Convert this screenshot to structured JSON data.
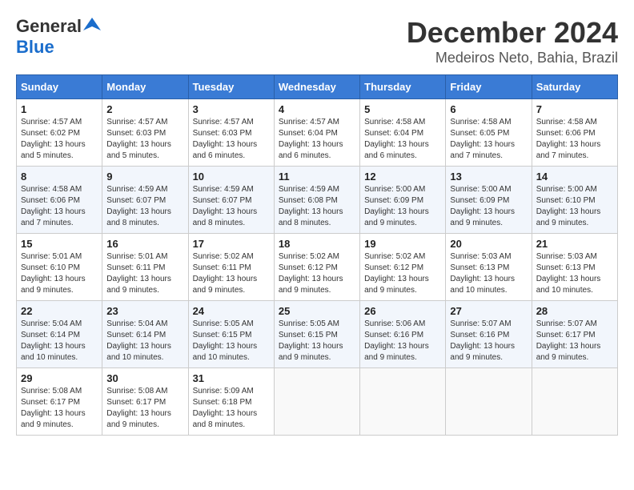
{
  "header": {
    "logo_general": "General",
    "logo_blue": "Blue",
    "month_title": "December 2024",
    "location": "Medeiros Neto, Bahia, Brazil"
  },
  "days_of_week": [
    "Sunday",
    "Monday",
    "Tuesday",
    "Wednesday",
    "Thursday",
    "Friday",
    "Saturday"
  ],
  "weeks": [
    [
      {
        "day": "1",
        "sunrise": "4:57 AM",
        "sunset": "6:02 PM",
        "daylight": "13 hours and 5 minutes."
      },
      {
        "day": "2",
        "sunrise": "4:57 AM",
        "sunset": "6:03 PM",
        "daylight": "13 hours and 5 minutes."
      },
      {
        "day": "3",
        "sunrise": "4:57 AM",
        "sunset": "6:03 PM",
        "daylight": "13 hours and 6 minutes."
      },
      {
        "day": "4",
        "sunrise": "4:57 AM",
        "sunset": "6:04 PM",
        "daylight": "13 hours and 6 minutes."
      },
      {
        "day": "5",
        "sunrise": "4:58 AM",
        "sunset": "6:04 PM",
        "daylight": "13 hours and 6 minutes."
      },
      {
        "day": "6",
        "sunrise": "4:58 AM",
        "sunset": "6:05 PM",
        "daylight": "13 hours and 7 minutes."
      },
      {
        "day": "7",
        "sunrise": "4:58 AM",
        "sunset": "6:06 PM",
        "daylight": "13 hours and 7 minutes."
      }
    ],
    [
      {
        "day": "8",
        "sunrise": "4:58 AM",
        "sunset": "6:06 PM",
        "daylight": "13 hours and 7 minutes."
      },
      {
        "day": "9",
        "sunrise": "4:59 AM",
        "sunset": "6:07 PM",
        "daylight": "13 hours and 8 minutes."
      },
      {
        "day": "10",
        "sunrise": "4:59 AM",
        "sunset": "6:07 PM",
        "daylight": "13 hours and 8 minutes."
      },
      {
        "day": "11",
        "sunrise": "4:59 AM",
        "sunset": "6:08 PM",
        "daylight": "13 hours and 8 minutes."
      },
      {
        "day": "12",
        "sunrise": "5:00 AM",
        "sunset": "6:09 PM",
        "daylight": "13 hours and 9 minutes."
      },
      {
        "day": "13",
        "sunrise": "5:00 AM",
        "sunset": "6:09 PM",
        "daylight": "13 hours and 9 minutes."
      },
      {
        "day": "14",
        "sunrise": "5:00 AM",
        "sunset": "6:10 PM",
        "daylight": "13 hours and 9 minutes."
      }
    ],
    [
      {
        "day": "15",
        "sunrise": "5:01 AM",
        "sunset": "6:10 PM",
        "daylight": "13 hours and 9 minutes."
      },
      {
        "day": "16",
        "sunrise": "5:01 AM",
        "sunset": "6:11 PM",
        "daylight": "13 hours and 9 minutes."
      },
      {
        "day": "17",
        "sunrise": "5:02 AM",
        "sunset": "6:11 PM",
        "daylight": "13 hours and 9 minutes."
      },
      {
        "day": "18",
        "sunrise": "5:02 AM",
        "sunset": "6:12 PM",
        "daylight": "13 hours and 9 minutes."
      },
      {
        "day": "19",
        "sunrise": "5:02 AM",
        "sunset": "6:12 PM",
        "daylight": "13 hours and 9 minutes."
      },
      {
        "day": "20",
        "sunrise": "5:03 AM",
        "sunset": "6:13 PM",
        "daylight": "13 hours and 10 minutes."
      },
      {
        "day": "21",
        "sunrise": "5:03 AM",
        "sunset": "6:13 PM",
        "daylight": "13 hours and 10 minutes."
      }
    ],
    [
      {
        "day": "22",
        "sunrise": "5:04 AM",
        "sunset": "6:14 PM",
        "daylight": "13 hours and 10 minutes."
      },
      {
        "day": "23",
        "sunrise": "5:04 AM",
        "sunset": "6:14 PM",
        "daylight": "13 hours and 10 minutes."
      },
      {
        "day": "24",
        "sunrise": "5:05 AM",
        "sunset": "6:15 PM",
        "daylight": "13 hours and 10 minutes."
      },
      {
        "day": "25",
        "sunrise": "5:05 AM",
        "sunset": "6:15 PM",
        "daylight": "13 hours and 9 minutes."
      },
      {
        "day": "26",
        "sunrise": "5:06 AM",
        "sunset": "6:16 PM",
        "daylight": "13 hours and 9 minutes."
      },
      {
        "day": "27",
        "sunrise": "5:07 AM",
        "sunset": "6:16 PM",
        "daylight": "13 hours and 9 minutes."
      },
      {
        "day": "28",
        "sunrise": "5:07 AM",
        "sunset": "6:17 PM",
        "daylight": "13 hours and 9 minutes."
      }
    ],
    [
      {
        "day": "29",
        "sunrise": "5:08 AM",
        "sunset": "6:17 PM",
        "daylight": "13 hours and 9 minutes."
      },
      {
        "day": "30",
        "sunrise": "5:08 AM",
        "sunset": "6:17 PM",
        "daylight": "13 hours and 9 minutes."
      },
      {
        "day": "31",
        "sunrise": "5:09 AM",
        "sunset": "6:18 PM",
        "daylight": "13 hours and 8 minutes."
      },
      null,
      null,
      null,
      null
    ]
  ]
}
